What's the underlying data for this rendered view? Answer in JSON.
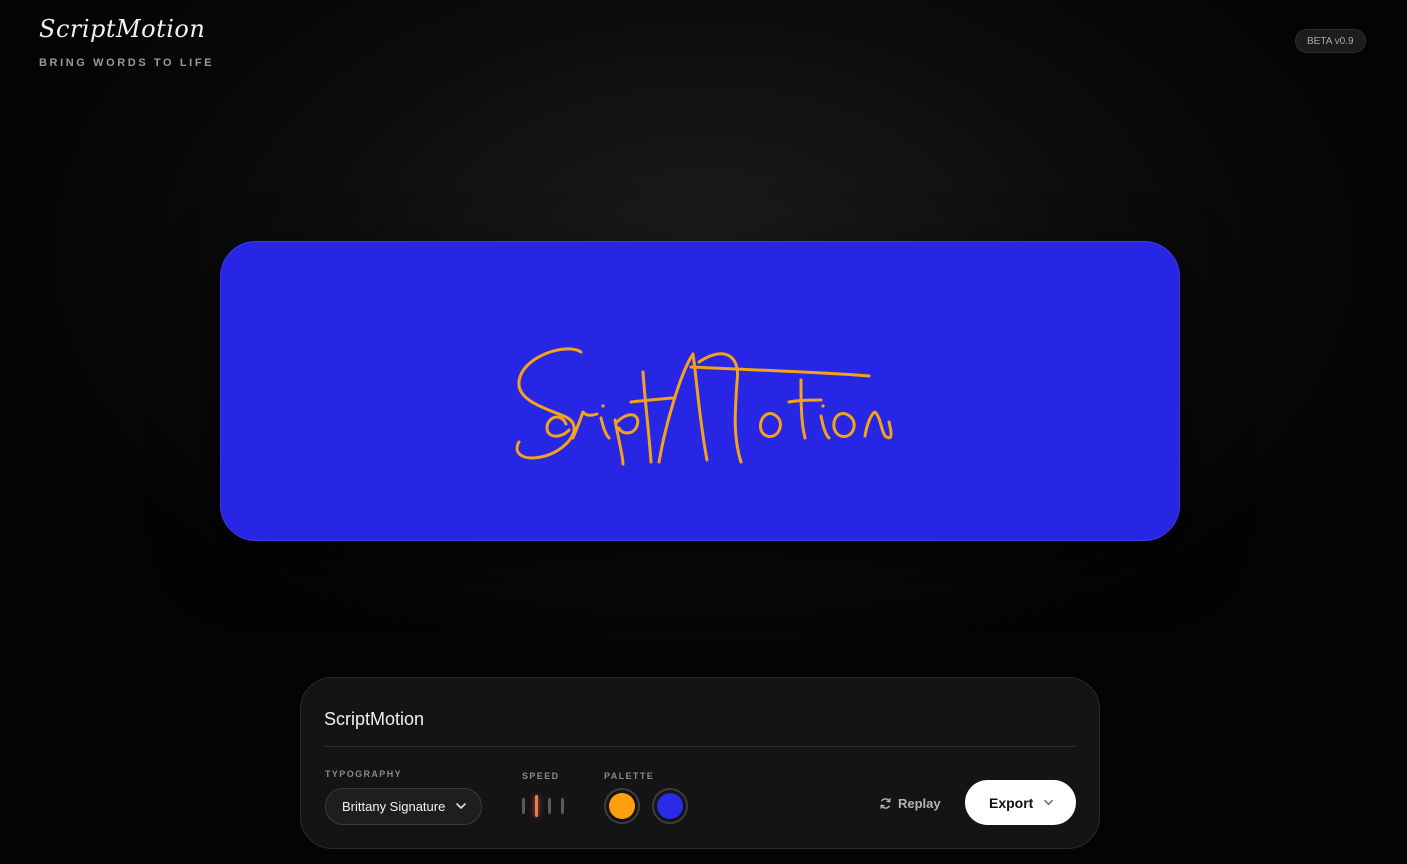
{
  "header": {
    "logo": "ScriptMotion",
    "tagline": "BRING WORDS TO LIFE",
    "badge": "BETA v0.9"
  },
  "preview": {
    "text": "ScriptMotion",
    "background_color": "#2626e4",
    "ink_color": "#f5a21a"
  },
  "controls": {
    "text_value": "ScriptMotion",
    "typography_label": "TYPOGRAPHY",
    "typography_value": "Brittany Signature",
    "speed_label": "SPEED",
    "speed_levels": 4,
    "speed_selected": 2,
    "palette_label": "PALETTE",
    "palette": [
      {
        "name": "ink",
        "color": "#ff9e0f"
      },
      {
        "name": "background",
        "color": "#2a2ae8"
      }
    ],
    "replay_label": "Replay",
    "export_label": "Export"
  },
  "icons": {
    "typography_chevron": "chevron-down-icon",
    "replay": "refresh-icon",
    "export_chevron": "chevron-down-icon"
  }
}
